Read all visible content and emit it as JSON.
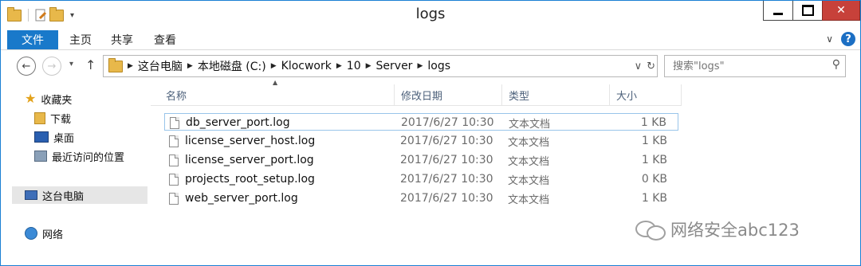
{
  "window": {
    "title": "logs"
  },
  "ribbon": {
    "tabs": [
      "文件",
      "主页",
      "共享",
      "查看"
    ]
  },
  "address": {
    "segments": [
      "这台电脑",
      "本地磁盘 (C:)",
      "Klocwork",
      "10",
      "Server",
      "logs"
    ]
  },
  "search": {
    "placeholder": "搜索\"logs\""
  },
  "nav": {
    "favorites": "收藏夹",
    "items": [
      "下载",
      "桌面",
      "最近访问的位置"
    ],
    "thispc": "这台电脑",
    "network": "网络"
  },
  "columns": {
    "name": "名称",
    "date": "修改日期",
    "type": "类型",
    "size": "大小"
  },
  "files": [
    {
      "name": "db_server_port.log",
      "date": "2017/6/27 10:30",
      "type": "文本文档",
      "size": "1 KB"
    },
    {
      "name": "license_server_host.log",
      "date": "2017/6/27 10:30",
      "type": "文本文档",
      "size": "1 KB"
    },
    {
      "name": "license_server_port.log",
      "date": "2017/6/27 10:30",
      "type": "文本文档",
      "size": "1 KB"
    },
    {
      "name": "projects_root_setup.log",
      "date": "2017/6/27 10:30",
      "type": "文本文档",
      "size": "0 KB"
    },
    {
      "name": "web_server_port.log",
      "date": "2017/6/27 10:30",
      "type": "文本文档",
      "size": "1 KB"
    }
  ],
  "watermark": "网络安全abc123"
}
